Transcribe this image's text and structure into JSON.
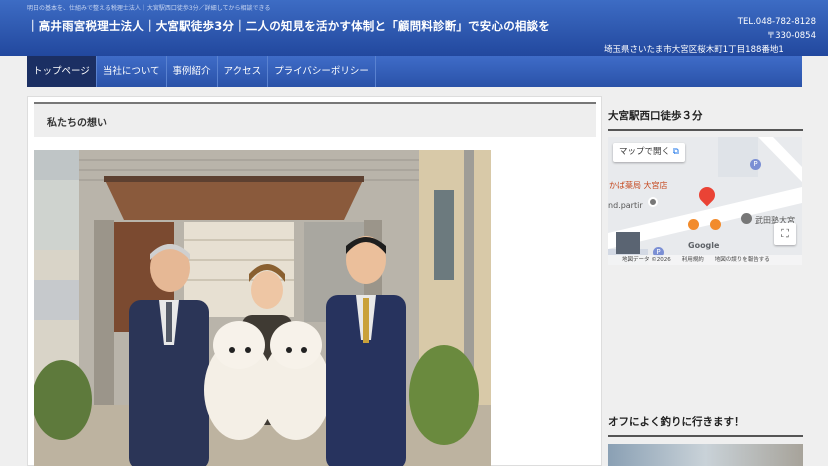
{
  "header": {
    "tagline": "明日の基本を、仕組みで整える税理士法人｜大宮駅西口徒歩3分／詳細してから相談できる",
    "title": "｜高井雨宮税理士法人｜大宮駅徒歩3分｜二人の知見を活かす体制と「顧問料診断」で安心の相談を",
    "tel": "TEL.048-782-8128",
    "postal": "〒330-0854",
    "address": "埼玉県さいたま市大宮区桜木町1丁目188番地1"
  },
  "nav": {
    "items": [
      "トップページ",
      "当社について",
      "事例紹介",
      "アクセス",
      "プライバシーポリシー"
    ],
    "active_index": 0
  },
  "main": {
    "heading": "私たちの想い"
  },
  "sidebar": {
    "access_heading": "大宮駅西口徒歩３分",
    "map": {
      "open_button": "マップで開く",
      "label_pharmacy": "かば薬局 大宮店",
      "label_partial": "nd.partir",
      "label_juku": "武田塾大宮",
      "footer": "地図データ ©2026　　利用規約　　地図の誤りを報告する",
      "google": "Google"
    },
    "hobby_heading": "オフによく釣りに行きます！"
  },
  "colors": {
    "header_top": "#3d6cc4",
    "header_bottom": "#22489e",
    "nav_active": "#1b2f63"
  }
}
